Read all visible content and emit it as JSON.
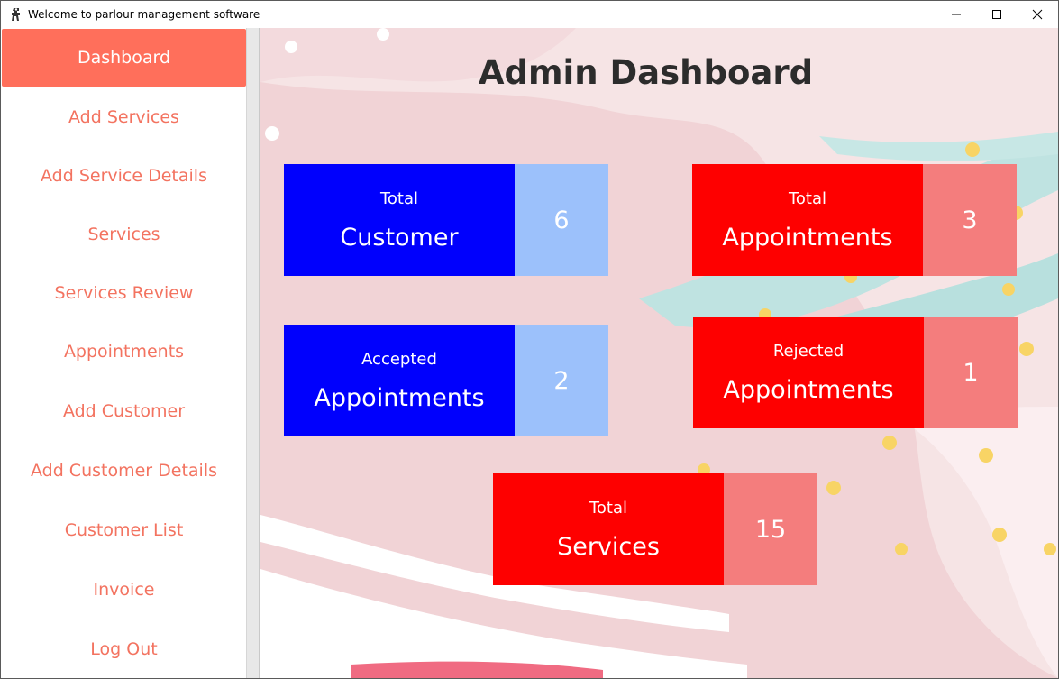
{
  "window": {
    "title": "Welcome to parlour management software",
    "icon": "barber-chair-icon",
    "controls": {
      "minimize": "minimize-icon",
      "maximize": "maximize-icon",
      "close": "close-icon"
    }
  },
  "sidebar": {
    "items": [
      {
        "label": "Dashboard",
        "active": true
      },
      {
        "label": "Add Services"
      },
      {
        "label": "Add Service Details"
      },
      {
        "label": "Services"
      },
      {
        "label": "Services Review"
      },
      {
        "label": "Appointments"
      },
      {
        "label": "Add Customer"
      },
      {
        "label": "Add Customer Details"
      },
      {
        "label": "Customer List"
      },
      {
        "label": "Invoice"
      },
      {
        "label": "Log Out"
      }
    ]
  },
  "main": {
    "title": "Admin Dashboard",
    "cards": [
      {
        "small": "Total",
        "big": "Customer",
        "value": "6",
        "color": "blue"
      },
      {
        "small": "Total",
        "big": "Appointments",
        "value": "3",
        "color": "red"
      },
      {
        "small": "Accepted",
        "big": "Appointments",
        "value": "2",
        "color": "blue"
      },
      {
        "small": "Rejected",
        "big": "Appointments",
        "value": "1",
        "color": "red"
      },
      {
        "small": "Total",
        "big": "Services",
        "value": "15",
        "color": "red"
      }
    ]
  },
  "colors": {
    "sidebar_active_bg": "#ff6f5b",
    "sidebar_text": "#f37360",
    "card_blue": "#0000fd",
    "card_blue_value": "#9cc1fb",
    "card_red": "#fe0000",
    "card_red_value": "#f47d7d"
  }
}
